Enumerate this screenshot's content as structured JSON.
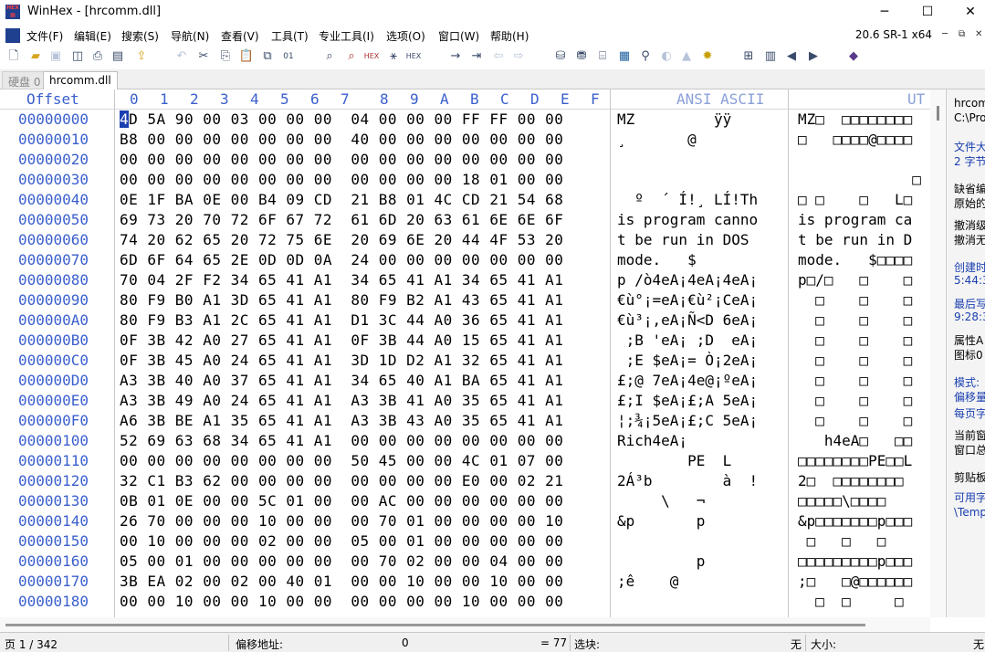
{
  "window": {
    "title": "WinHex - [hrcomm.dll]",
    "minimize": "─",
    "maximize": "☐",
    "close": "✕"
  },
  "menu": {
    "items": [
      "文件(F)",
      "编辑(E)",
      "搜索(S)",
      "导航(N)",
      "查看(V)",
      "工具(T)",
      "专业工具(I)",
      "选项(O)",
      "窗口(W)",
      "帮助(H)"
    ],
    "version": "20.6 SR-1 x64"
  },
  "tabs": {
    "disk": "硬盘 0",
    "file": "hrcomm.dll"
  },
  "hex_header": {
    "offset": "Offset",
    "columns": [
      "0",
      "1",
      "2",
      "3",
      "4",
      "5",
      "6",
      "7",
      "8",
      "9",
      "A",
      "B",
      "C",
      "D",
      "E",
      "F"
    ],
    "ansi": "ANSI ASCII",
    "ut": "UT"
  },
  "rows": [
    {
      "offset": "00000000",
      "first": "4",
      "hex_rest": "D 5A 90 00 03 00 00 00  04 00 00 00 FF FF 00 00",
      "ansi": "MZ         ÿÿ",
      "ut": "MZ□  □□□□□□□□"
    },
    {
      "offset": "00000010",
      "hex": "B8 00 00 00 00 00 00 00  40 00 00 00 00 00 00 00",
      "ansi": "¸       @",
      "ut": "□   □□□□@□□□□"
    },
    {
      "offset": "00000020",
      "hex": "00 00 00 00 00 00 00 00  00 00 00 00 00 00 00 00",
      "ansi": "",
      "ut": ""
    },
    {
      "offset": "00000030",
      "hex": "00 00 00 00 00 00 00 00  00 00 00 00 18 01 00 00",
      "ansi": "",
      "ut": "             □"
    },
    {
      "offset": "00000040",
      "hex": "0E 1F BA 0E 00 B4 09 CD  21 B8 01 4C CD 21 54 68",
      "ansi": "  º  ´ Í!¸ LÍ!Th",
      "ut": "□ □    □   L□"
    },
    {
      "offset": "00000050",
      "hex": "69 73 20 70 72 6F 67 72  61 6D 20 63 61 6E 6E 6F",
      "ansi": "is program canno",
      "ut": "is program ca"
    },
    {
      "offset": "00000060",
      "hex": "74 20 62 65 20 72 75 6E  20 69 6E 20 44 4F 53 20",
      "ansi": "t be run in DOS ",
      "ut": "t be run in D"
    },
    {
      "offset": "00000070",
      "hex": "6D 6F 64 65 2E 0D 0D 0A  24 00 00 00 00 00 00 00",
      "ansi": "mode.   $",
      "ut": "mode.   $□□□□"
    },
    {
      "offset": "00000080",
      "hex": "70 04 2F F2 34 65 41 A1  34 65 41 A1 34 65 41 A1",
      "ansi": "p /ò4eA¡4eA¡4eA¡",
      "ut": "p□/□   □    □"
    },
    {
      "offset": "00000090",
      "hex": "80 F9 B0 A1 3D 65 41 A1  80 F9 B2 A1 43 65 41 A1",
      "ansi": "€ù°¡=eA¡€ù²¡CeA¡",
      "ut": "  □    □    □"
    },
    {
      "offset": "000000A0",
      "hex": "80 F9 B3 A1 2C 65 41 A1  D1 3C 44 A0 36 65 41 A1",
      "ansi": "€ù³¡,eA¡Ñ<D 6eA¡",
      "ut": "  □    □    □"
    },
    {
      "offset": "000000B0",
      "hex": "0F 3B 42 A0 27 65 41 A1  0F 3B 44 A0 15 65 41 A1",
      "ansi": " ;B 'eA¡ ;D  eA¡",
      "ut": "  □    □    □"
    },
    {
      "offset": "000000C0",
      "hex": "0F 3B 45 A0 24 65 41 A1  3D 1D D2 A1 32 65 41 A1",
      "ansi": " ;E $eA¡= Ò¡2eA¡",
      "ut": "  □    □    □"
    },
    {
      "offset": "000000D0",
      "hex": "A3 3B 40 A0 37 65 41 A1  34 65 40 A1 BA 65 41 A1",
      "ansi": "£;@ 7eA¡4e@¡ºeA¡",
      "ut": "  □    □    □"
    },
    {
      "offset": "000000E0",
      "hex": "A3 3B 49 A0 24 65 41 A1  A3 3B 41 A0 35 65 41 A1",
      "ansi": "£;I $eA¡£;A 5eA¡",
      "ut": "  □    □    □"
    },
    {
      "offset": "000000F0",
      "hex": "A6 3B BE A1 35 65 41 A1  A3 3B 43 A0 35 65 41 A1",
      "ansi": "¦;¾¡5eA¡£;C 5eA¡",
      "ut": "  □    □    □"
    },
    {
      "offset": "00000100",
      "hex": "52 69 63 68 34 65 41 A1  00 00 00 00 00 00 00 00",
      "ansi": "Rich4eA¡",
      "ut": "   h4eA□   □□"
    },
    {
      "offset": "00000110",
      "hex": "00 00 00 00 00 00 00 00  50 45 00 00 4C 01 07 00",
      "ansi": "        PE  L",
      "ut": "□□□□□□□□PE□□L"
    },
    {
      "offset": "00000120",
      "hex": "32 C1 B3 62 00 00 00 00  00 00 00 00 E0 00 02 21",
      "ansi": "2Á³b        à  !",
      "ut": "2□  □□□□□□□□"
    },
    {
      "offset": "00000130",
      "hex": "0B 01 0E 00 00 5C 01 00  00 AC 00 00 00 00 00 00",
      "ansi": "     \\   ¬",
      "ut": "□□□□□\\□□□□"
    },
    {
      "offset": "00000140",
      "hex": "26 70 00 00 00 10 00 00  00 70 01 00 00 00 00 10",
      "ansi": "&p       p",
      "ut": "&p□□□□□□□p□□□"
    },
    {
      "offset": "00000150",
      "hex": "00 10 00 00 00 02 00 00  05 00 01 00 00 00 00 00",
      "ansi": "",
      "ut": " □   □   □"
    },
    {
      "offset": "00000160",
      "hex": "05 00 01 00 00 00 00 00  00 70 02 00 00 04 00 00",
      "ansi": "         p",
      "ut": "□□□□□□□□□p□□□"
    },
    {
      "offset": "00000170",
      "hex": "3B EA 02 00 02 00 40 01  00 00 10 00 00 10 00 00",
      "ansi": ";ê    @",
      "ut": ";□   □@□□□□□□"
    },
    {
      "offset": "00000180",
      "hex": "00 00 10 00 00 10 00 00  00 00 00 00 10 00 00 00",
      "ansi": "",
      "ut": "  □  □     □"
    }
  ],
  "right_panel": {
    "items": [
      "hrcom",
      "C:\\Pro",
      "文件大",
      "2 字节",
      "缺省编",
      "原始的",
      "撤消级",
      "撤消无",
      "创建时",
      "5:44:32",
      "最后写",
      "9:28:34",
      "属性A",
      "图标0",
      "模式:",
      "偏移量",
      "每页字",
      "当前窗",
      "窗口总",
      "剪贴板",
      "可用字",
      "\\Temp"
    ]
  },
  "status": {
    "page": "页 1 / 342",
    "offset_label": "偏移地址:",
    "offset_value": "0",
    "eq_value": "= 77",
    "block_label": "选块:",
    "block_value": "无",
    "size_label": "大小:",
    "size_value": "无"
  }
}
